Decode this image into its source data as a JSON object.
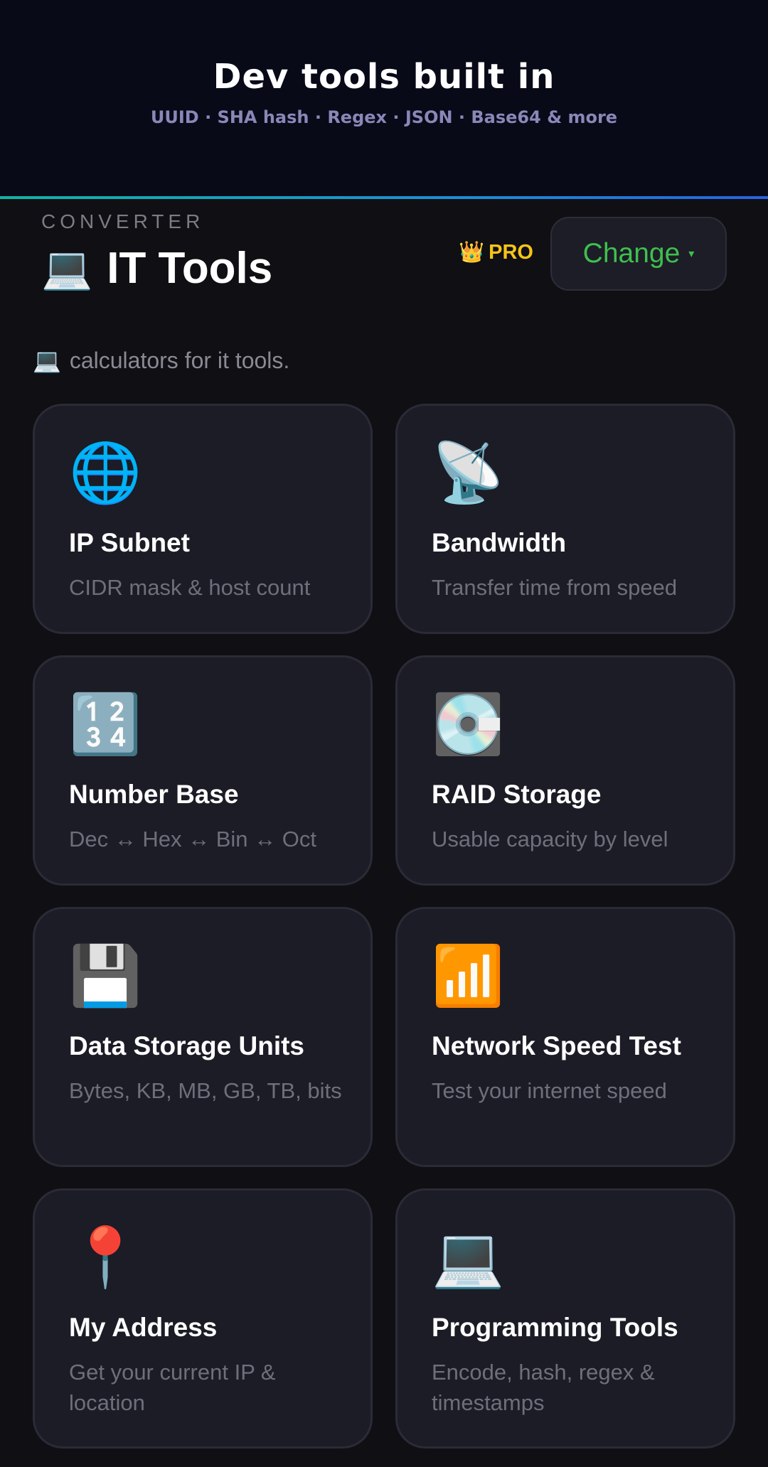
{
  "banner": {
    "title": "Dev tools built in",
    "subtitle": "UUID · SHA hash · Regex · JSON · Base64 & more"
  },
  "header": {
    "eyebrow": "CONVERTER",
    "title_icon": "💻",
    "title": "IT Tools",
    "pro_icon": "👑",
    "pro_label": "PRO",
    "change_label": "Change",
    "change_caret": "▾"
  },
  "intro": {
    "icon": "💻",
    "text": "calculators for it tools."
  },
  "cards": [
    {
      "icon": "🌐",
      "icon_name": "globe-icon",
      "title": "IP Subnet",
      "desc": "CIDR mask & host count"
    },
    {
      "icon": "📡",
      "icon_name": "satellite-dish-icon",
      "title": "Bandwidth",
      "desc": "Transfer time from speed"
    },
    {
      "icon": "🔢",
      "icon_name": "numbers-icon",
      "title": "Number Base",
      "desc": "Dec ↔ Hex ↔ Bin ↔ Oct"
    },
    {
      "icon": "💽",
      "icon_name": "minidisc-icon",
      "title": "RAID Storage",
      "desc": "Usable capacity by level"
    },
    {
      "icon": "💾",
      "icon_name": "floppy-disk-icon",
      "title": "Data Storage Units",
      "desc": "Bytes, KB, MB, GB, TB, bits"
    },
    {
      "icon": "📶",
      "icon_name": "signal-bars-icon",
      "title": "Network Speed Test",
      "desc": "Test your internet speed"
    },
    {
      "icon": "📍",
      "icon_name": "location-pin-icon",
      "title": "My Address",
      "desc": "Get your current IP & location"
    },
    {
      "icon": "💻",
      "icon_name": "laptop-icon",
      "title": "Programming Tools",
      "desc": "Encode, hash, regex & timestamps"
    }
  ],
  "colors": {
    "accent_green": "#3fbf4f",
    "pro_gold": "#f5c518",
    "card_bg": "#1b1c26",
    "page_bg": "#0f0f14"
  }
}
